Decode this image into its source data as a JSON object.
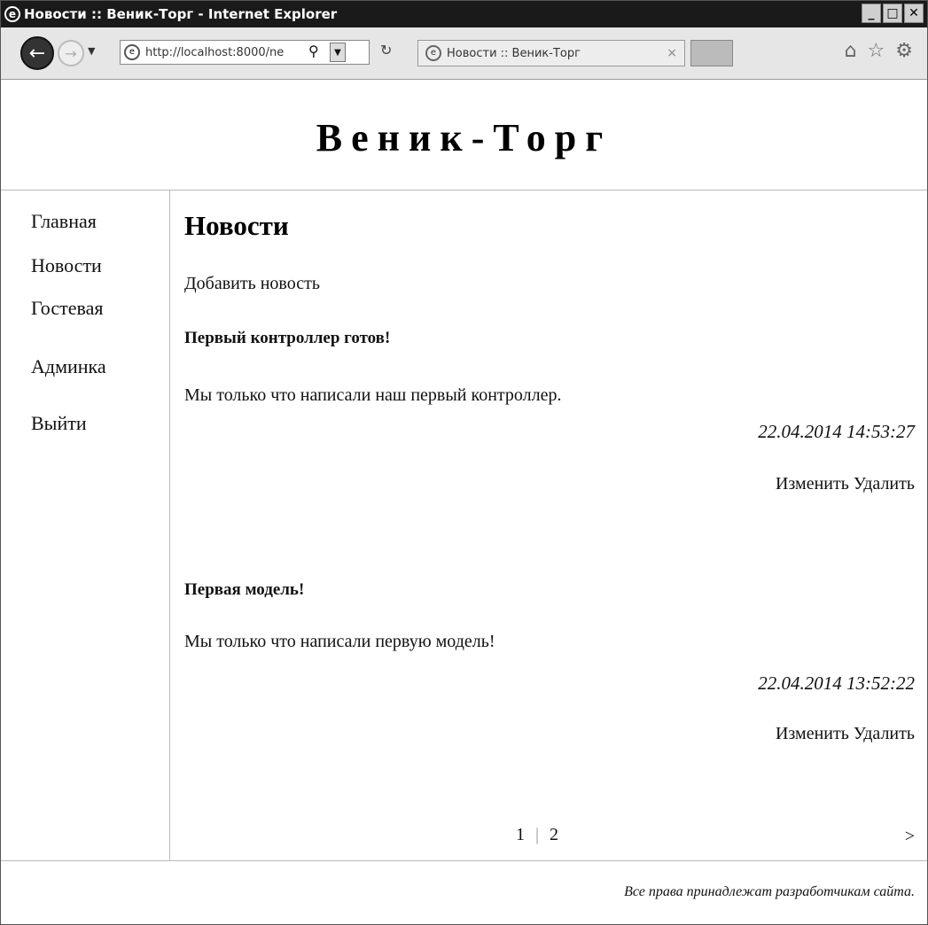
{
  "window": {
    "title": "Новости :: Веник-Торг - Internet Explorer",
    "minimize": "_",
    "maximize": "□",
    "close": "✕"
  },
  "browser": {
    "url": "http://localhost:8000/ne",
    "tab_title": "Новости :: Веник-Торг",
    "tab_close": "×",
    "toolbar_icons": [
      "home-icon",
      "star-icon",
      "gear-icon"
    ]
  },
  "site": {
    "logo": "Веник-Торг",
    "nav": [
      {
        "label": "Главная"
      },
      {
        "label": "Новости"
      },
      {
        "label": "Гостевая"
      },
      {
        "label": "Админка"
      },
      {
        "label": "Выйти"
      }
    ]
  },
  "main": {
    "title": "Новости",
    "add_link": "Добавить новость",
    "news": [
      {
        "title": "Первый контроллер готов!",
        "text": "Мы только что написали наш первый контроллер.",
        "date": "22.04.2014 14:53:27",
        "edit": "Изменить",
        "delete": "Удалить"
      },
      {
        "title": "Первая модель!",
        "text": "Мы только что написали первую модель!",
        "date": "22.04.2014 13:52:22",
        "edit": "Изменить",
        "delete": "Удалить"
      }
    ],
    "pagination": {
      "current": "1",
      "separator": "|",
      "page2": "2",
      "next": ">"
    }
  },
  "footer": {
    "copyright": "Все права принадлежат разработчикам сайта."
  }
}
